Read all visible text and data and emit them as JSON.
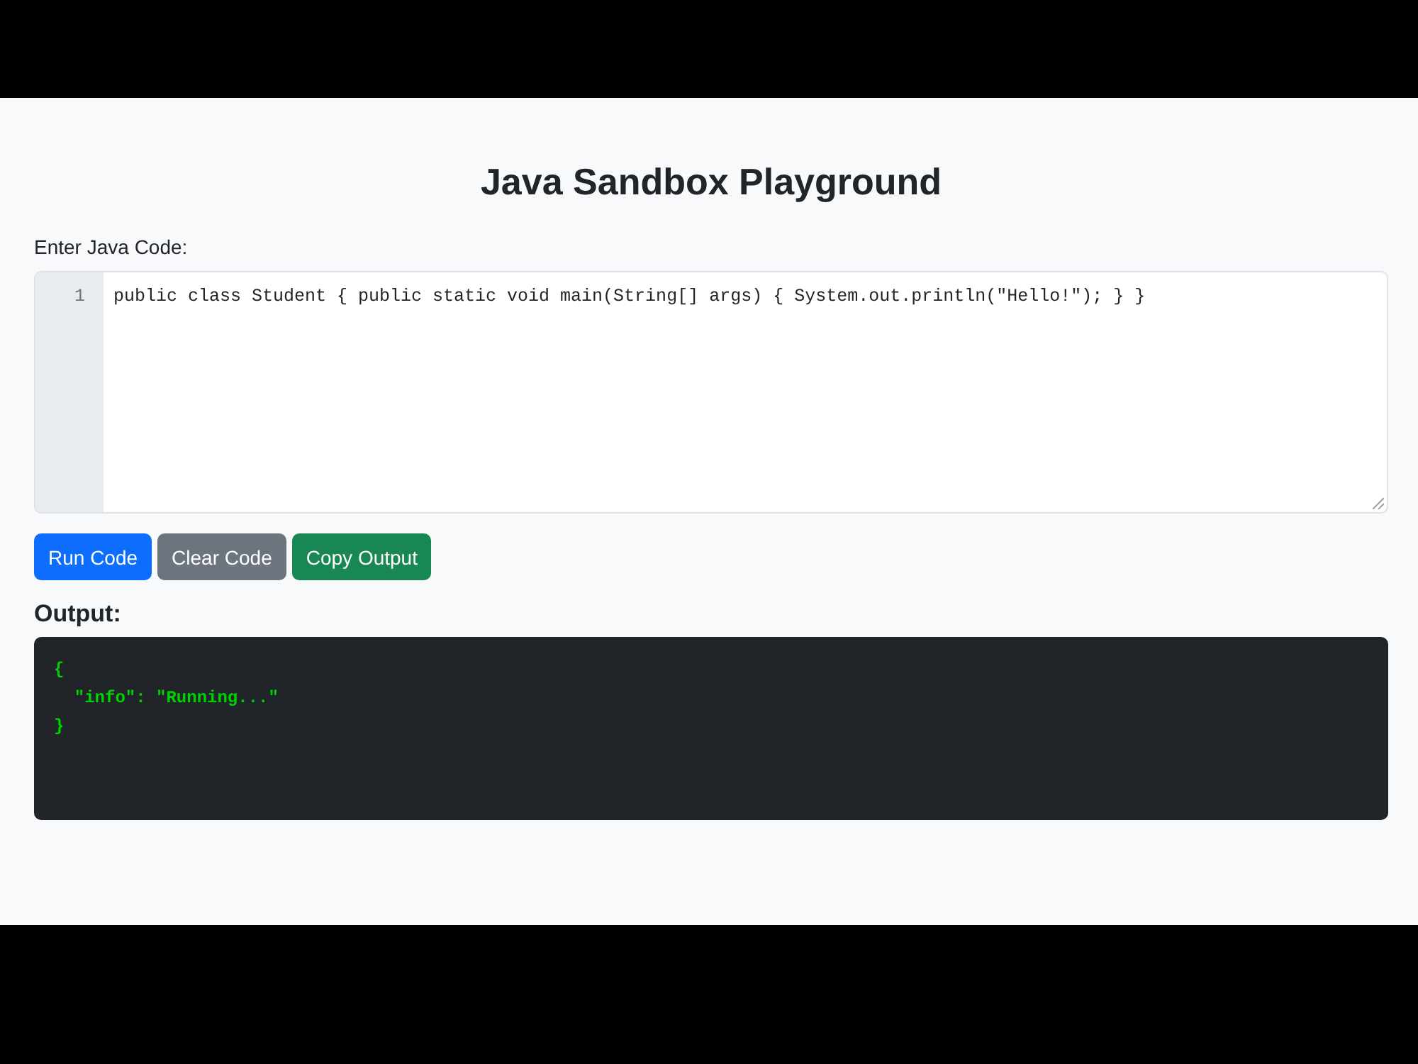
{
  "title": "Java Sandbox Playground",
  "editor": {
    "label": "Enter Java Code:",
    "lines": [
      {
        "number": "1",
        "code": "public class Student { public static void main(String[] args) { System.out.println(\"Hello!\"); } }"
      }
    ]
  },
  "buttons": [
    {
      "label": "Run Code",
      "kind": "run"
    },
    {
      "label": "Clear Code",
      "kind": "clear"
    },
    {
      "label": "Copy Output",
      "kind": "copy"
    }
  ],
  "output": {
    "heading": "Output:",
    "text": "{\n  \"info\": \"Running...\"\n}"
  }
}
